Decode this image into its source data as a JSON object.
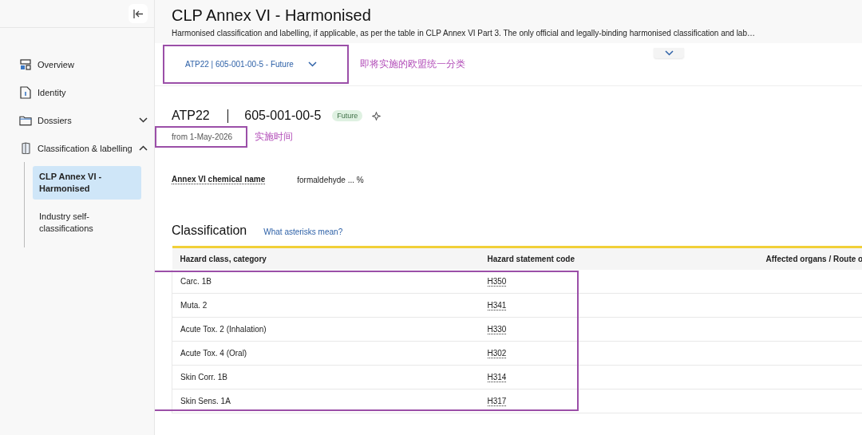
{
  "sidebar": {
    "items": [
      {
        "label": "Overview"
      },
      {
        "label": "Identity"
      },
      {
        "label": "Dossiers",
        "expanded": false
      },
      {
        "label": "Classification & labelling",
        "expanded": true,
        "children": [
          {
            "label": "CLP Annex VI - Harmonised",
            "selected": true
          },
          {
            "label": "Industry self-classifications",
            "selected": false
          }
        ]
      }
    ]
  },
  "header": {
    "title": "CLP Annex VI - Harmonised",
    "description": "Harmonised classification and labelling, if applicable, as per the table in CLP Annex VI Part 3. The only official and legally-binding harmonised classification and lab…"
  },
  "version_select": {
    "value": "ATP22 | 605-001-00-5 - Future",
    "note": "即将实施的欧盟统一分类"
  },
  "entry": {
    "atp": "ATP22",
    "index_number": "605-001-00-5",
    "status": "Future",
    "date": "from 1-May-2026",
    "date_note": "实施时间"
  },
  "chemical_name": {
    "label": "Annex VI chemical name",
    "value": "formaldehyde ... %"
  },
  "classification": {
    "title": "Classification",
    "help_link": "What asterisks mean?",
    "columns": [
      "Hazard class, category",
      "Hazard statement code",
      "Affected organs / Route o"
    ],
    "rows": [
      [
        "Carc. 1B",
        "H350"
      ],
      [
        "Muta. 2",
        "H341"
      ],
      [
        "Acute Tox. 2 (Inhalation)",
        "H330"
      ],
      [
        "Acute Tox. 4 (Oral)",
        "H302"
      ],
      [
        "Skin Corr. 1B",
        "H314"
      ],
      [
        "Skin Sens. 1A",
        "H317"
      ]
    ]
  }
}
